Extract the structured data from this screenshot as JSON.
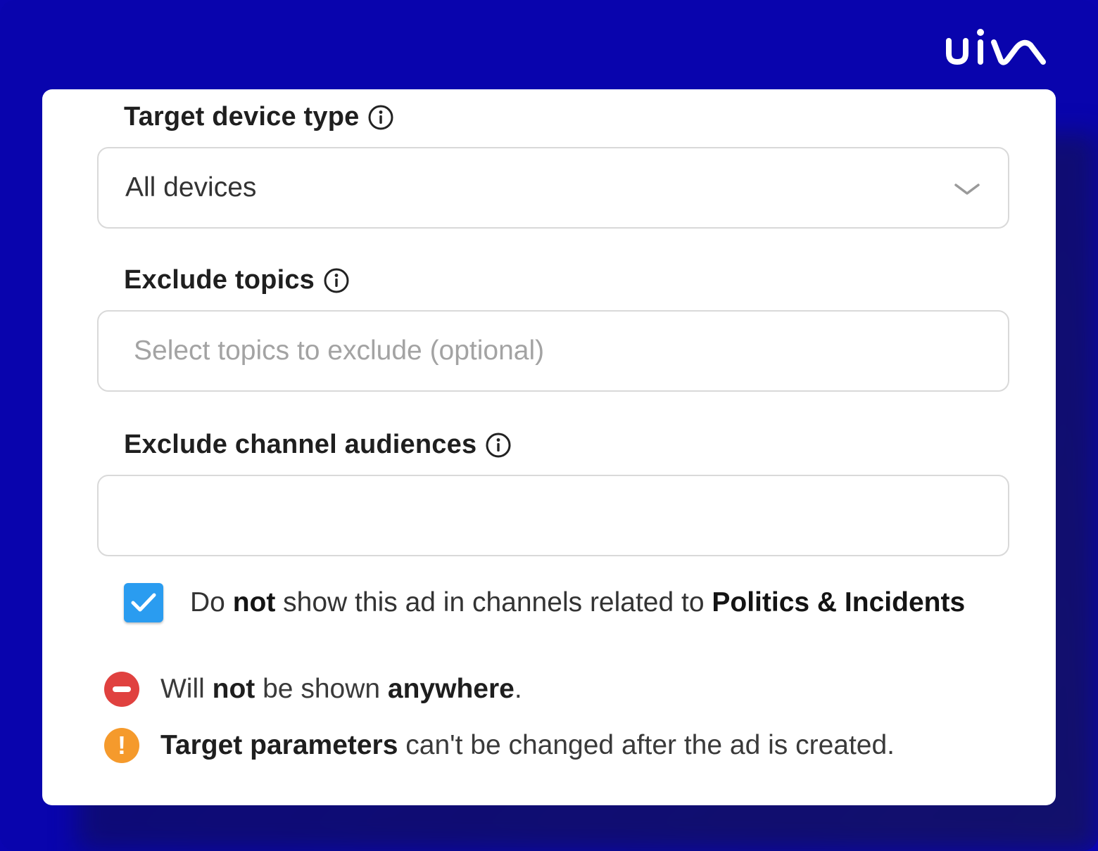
{
  "brand": {
    "logo_text": "uix",
    "background_color": "#0a04b0",
    "accent_color": "#2a9cf0"
  },
  "form": {
    "device_type": {
      "label": "Target device type",
      "info_icon": "info-circle-icon",
      "value": "All devices",
      "dropdown_icon": "chevron-down-icon"
    },
    "exclude_topics": {
      "label": "Exclude topics",
      "info_icon": "info-circle-icon",
      "placeholder": "Select topics to exclude (optional)"
    },
    "exclude_channel_audiences": {
      "label": "Exclude channel audiences",
      "info_icon": "info-circle-icon",
      "value": ""
    },
    "politics_checkbox": {
      "checked": true,
      "text_part1": "Do ",
      "text_bold1": "not",
      "text_part2": " show this ad in channels related to ",
      "text_bold2": "Politics & Incidents"
    }
  },
  "notices": [
    {
      "icon": "no-entry-icon",
      "color": "#e0413f",
      "text_part1": "Will ",
      "text_bold1": "not",
      "text_part2": " be shown ",
      "text_bold2": "anywhere",
      "text_part3": "."
    },
    {
      "icon": "warning-icon",
      "color": "#f59a2c",
      "glyph": "!",
      "text_bold1": "Target parameters",
      "text_part2": " can't be changed after the ad is created."
    }
  ]
}
